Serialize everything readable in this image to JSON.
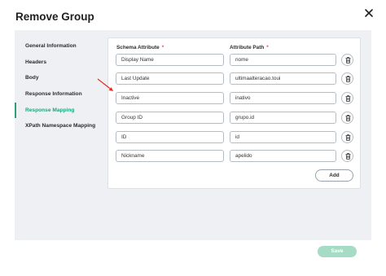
{
  "dialog": {
    "title": "Remove Group"
  },
  "nav": {
    "items": [
      {
        "label": "General Information"
      },
      {
        "label": "Headers"
      },
      {
        "label": "Body"
      },
      {
        "label": "Response Information"
      },
      {
        "label": "Response Mapping",
        "active": true
      },
      {
        "label": "XPath Namespace Mapping"
      }
    ]
  },
  "mapping": {
    "schema_header": "Schema Attribute",
    "path_header": "Attribute Path",
    "required_mark": "*",
    "rows": [
      {
        "schema": "Display Name",
        "path": "nome"
      },
      {
        "schema": "Last Update",
        "path": "ultimaalteracao.toui"
      },
      {
        "schema": "Inactive",
        "path": "inativo"
      },
      {
        "schema": "Group ID",
        "path": "grupo.id"
      },
      {
        "schema": "ID",
        "path": "id"
      },
      {
        "schema": "Nickname",
        "path": "apelido"
      }
    ],
    "add_label": "Add"
  },
  "footer": {
    "save_label": "Save"
  },
  "colors": {
    "accent": "#2aa07a",
    "save_disabled": "#a6dcc6",
    "required": "#e5484d",
    "annotation_arrow": "#d93025"
  },
  "icons": {
    "close": "close-icon",
    "delete": "trash-icon",
    "annotation": "red-arrow-annotation"
  }
}
